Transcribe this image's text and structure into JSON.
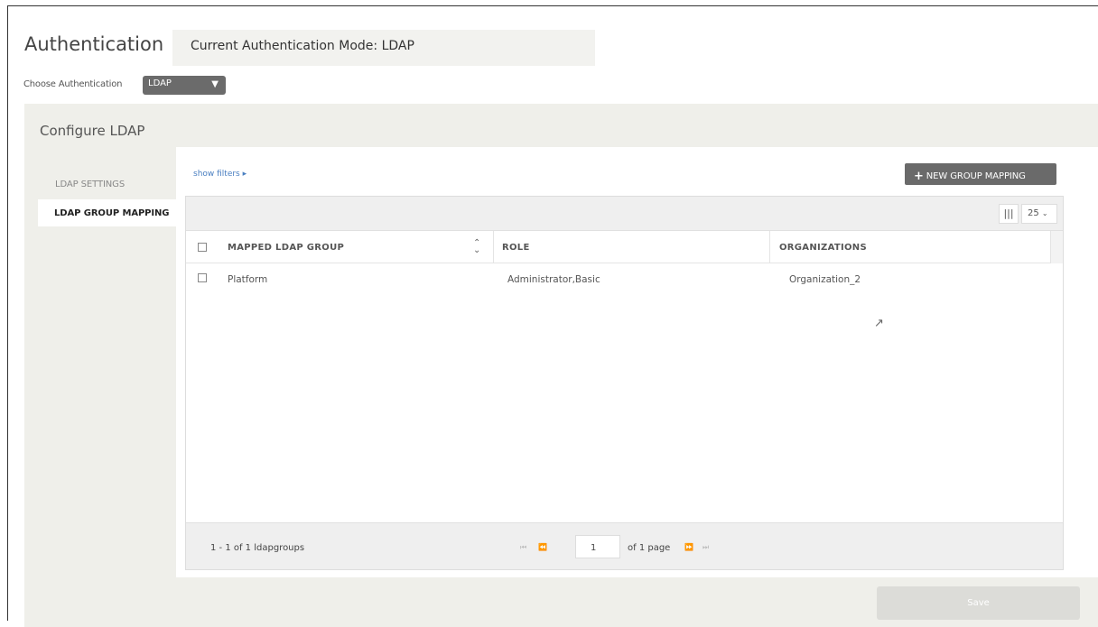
{
  "header": {
    "title": "Authentication",
    "mode_text": "Current Authentication Mode: LDAP"
  },
  "auth_chooser": {
    "label": "Choose Authentication",
    "selected": "LDAP"
  },
  "config": {
    "title": "Configure LDAP",
    "nav": [
      {
        "label": "LDAP SETTINGS",
        "active": false
      },
      {
        "label": "LDAP GROUP MAPPING",
        "active": true
      }
    ]
  },
  "mapping": {
    "show_filters": "show filters ▸",
    "new_button": "NEW GROUP MAPPING",
    "page_size": "25",
    "columns": [
      "MAPPED LDAP GROUP",
      "ROLE",
      "ORGANIZATIONS"
    ],
    "rows": [
      {
        "group": "Platform",
        "role": "Administrator,Basic",
        "organizations": "Organization_2"
      }
    ],
    "footer": {
      "count": "1 - 1 of 1 ldapgroups",
      "page": "1",
      "of_pages": "of 1 page"
    }
  },
  "actions": {
    "save": "Save"
  },
  "colors": {
    "link": "#4a7fc1",
    "button_dark": "#6a6a6a",
    "panel_bg": "#efefea",
    "save_disabled": "#dcdcd8"
  }
}
